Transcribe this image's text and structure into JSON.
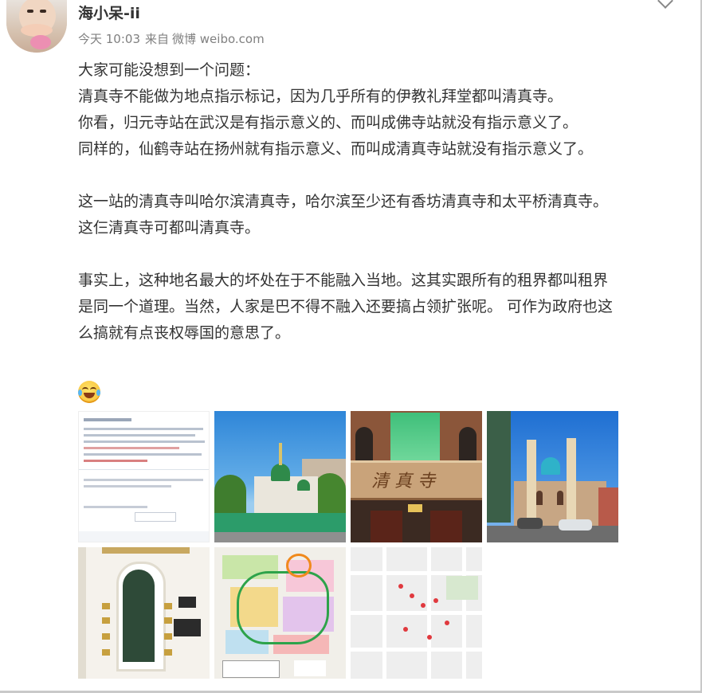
{
  "user": {
    "name": "海小呆-ii",
    "avatar": "avatar"
  },
  "meta": {
    "time": "今天 10:03",
    "source_prefix": "来自",
    "source": "微博 weibo.com"
  },
  "post": {
    "lines": [
      "大家可能没想到一个问题：",
      "清真寺不能做为地点指示标记，因为几乎所有的伊教礼拜堂都叫清真寺。",
      "你看，归元寺站在武汉是有指示意义的、而叫成佛寺站就没有指示意义了。",
      "同样的，仙鹤寺站在扬州就有指示意义、而叫成清真寺站就没有指示意义了。",
      "",
      "这一站的清真寺叫哈尔滨清真寺，哈尔滨至少还有香坊清真寺和太平桥清真寺。",
      "这仨清真寺可都叫清真寺。",
      "",
      "事实上，这种地名最大的坏处在于不能融入当地。这其实跟所有的租界都叫租界",
      "是同一个道理。当然，人家是巴不得不融入还要搞占领扩张呢。 可作为政府也这",
      "么搞就有点丧权辱国的意思了。"
    ],
    "emoji": "laugh-cry-emoji"
  },
  "images": {
    "storefront_sign": "清 真 寺"
  },
  "icons": {
    "more": "chevron-down-icon"
  }
}
